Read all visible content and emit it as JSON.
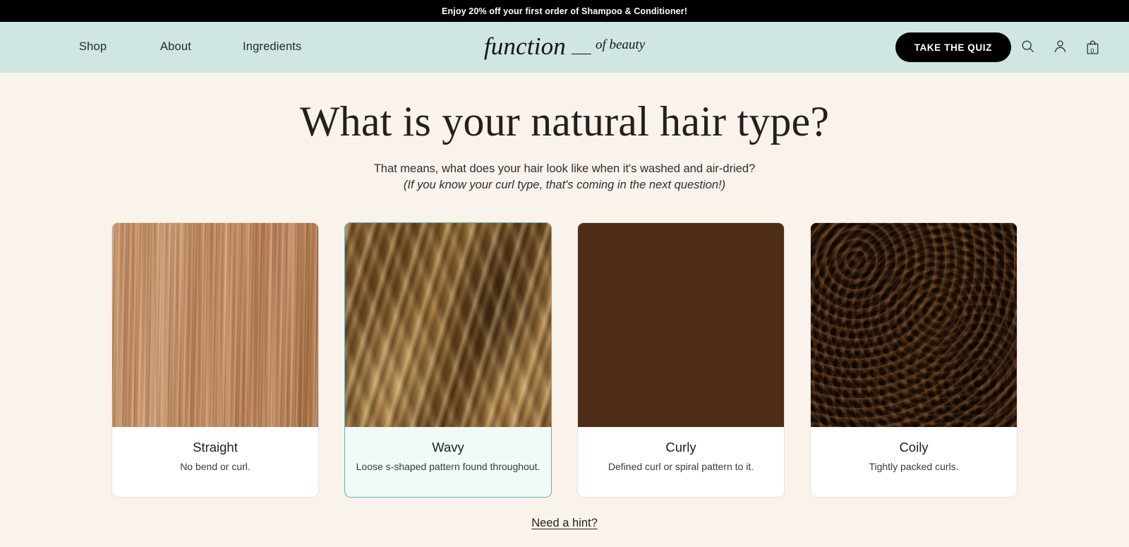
{
  "announcement": {
    "text": "Enjoy 20% off your first order of Shampoo & Conditioner!"
  },
  "header": {
    "nav": [
      {
        "label": "Shop"
      },
      {
        "label": "About"
      },
      {
        "label": "Ingredients"
      }
    ],
    "logo": {
      "main": "function",
      "sub": "of beauty"
    },
    "quiz_button": "TAKE THE QUIZ",
    "icons": {
      "search": "search-icon",
      "account": "account-icon",
      "cart": "cart-icon"
    },
    "cart_count": "0",
    "background_color": "#cfe6e2"
  },
  "quiz": {
    "title": "What is your natural hair type?",
    "subtitle": "That means, what does your hair look like when it's washed and air-dried?",
    "note": "(If you know your curl type, that's coming in the next question!)",
    "hint_link": "Need a hint?",
    "selected_option": "Wavy",
    "accent_color": "#5bb7b0",
    "page_background": "#faf3ec",
    "options": [
      {
        "title": "Straight",
        "description": "No bend or curl.",
        "image": "straight-hair-photo",
        "selected": false
      },
      {
        "title": "Wavy",
        "description": "Loose s-shaped pattern found throughout.",
        "image": "wavy-hair-photo",
        "selected": true
      },
      {
        "title": "Curly",
        "description": "Defined curl or spiral pattern to it.",
        "image": "curly-hair-photo",
        "selected": false
      },
      {
        "title": "Coily",
        "description": "Tightly packed curls.",
        "image": "coily-hair-photo",
        "selected": false
      }
    ]
  }
}
